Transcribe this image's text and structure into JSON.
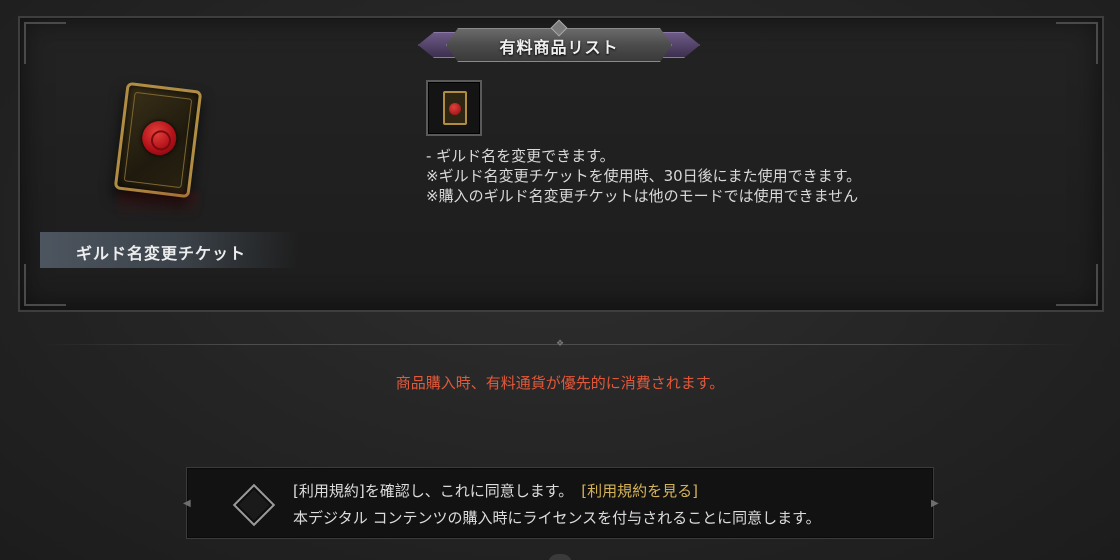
{
  "panel": {
    "title": "有料商品リスト"
  },
  "product": {
    "name": "ギルド名変更チケット",
    "icon": "guild-name-ticket-icon",
    "description": [
      "- ギルド名を変更できます。",
      "※ギルド名変更チケットを使用時、30日後にまた使用できます。",
      "※購入のギルド名変更チケットは他のモードでは使用できません"
    ]
  },
  "notice": "商品購入時、有料通貨が優先的に消費されます。",
  "agreement": {
    "line1": "[利用規約]を確認し、これに同意します。",
    "terms_link": "[利用規約を見る]",
    "line2": "本デジタル コンテンツの購入時にライセンスを付与されることに同意します。",
    "checked": false
  },
  "colors": {
    "notice": "#e2583a",
    "link": "#d4b258",
    "seal": "#c8191f",
    "card_border": "#b08d43"
  }
}
